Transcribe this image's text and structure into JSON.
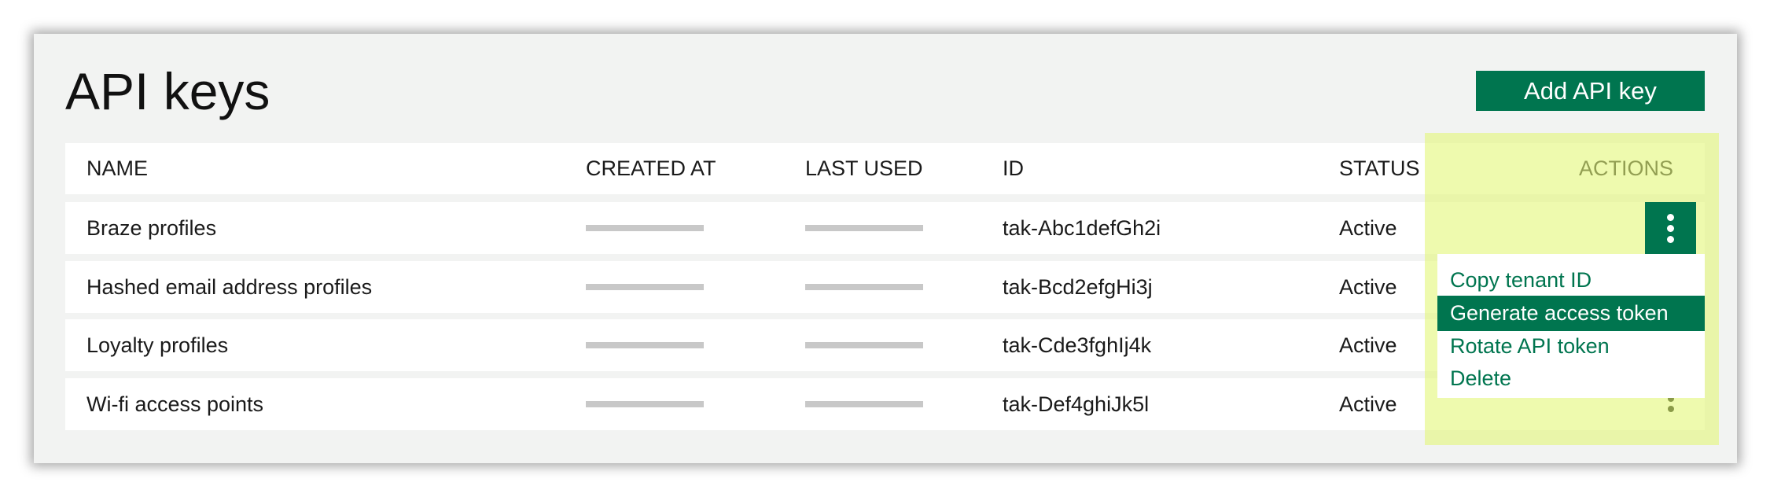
{
  "page": {
    "title": "API keys",
    "add_button_label": "Add API key"
  },
  "colors": {
    "accent": "#00754f",
    "highlight": "#eef9a8",
    "panel_bg": "#f2f3f2"
  },
  "table": {
    "headers": {
      "name": "NAME",
      "created_at": "CREATED AT",
      "last_used": "LAST USED",
      "id": "ID",
      "status": "STATUS",
      "actions": "ACTIONS"
    },
    "rows": [
      {
        "name": "Braze profiles",
        "id": "tak-Abc1defGh2i",
        "status": "Active"
      },
      {
        "name": "Hashed email address profiles",
        "id": "tak-Bcd2efgHi3j",
        "status": "Active"
      },
      {
        "name": "Loyalty profiles",
        "id": "tak-Cde3fghIj4k",
        "status": "Active"
      },
      {
        "name": "Wi-fi access points",
        "id": "tak-Def4ghiJk5l",
        "status": "Active"
      }
    ]
  },
  "actions_menu": {
    "icon": "kebab-vertical-icon",
    "items": [
      {
        "label": "Copy tenant ID"
      },
      {
        "label": "Generate access token",
        "highlighted": true
      },
      {
        "label": "Rotate API token"
      },
      {
        "label": "Delete"
      }
    ]
  }
}
